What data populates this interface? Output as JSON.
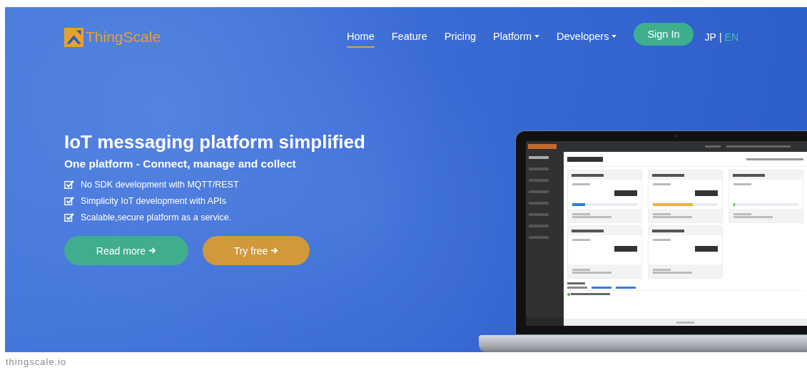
{
  "nav": {
    "logo": "ThingScale",
    "links": [
      {
        "label": "Home",
        "selected": true,
        "dropdown": false
      },
      {
        "label": "Feature",
        "selected": false,
        "dropdown": false
      },
      {
        "label": "Pricing",
        "selected": false,
        "dropdown": false
      },
      {
        "label": "Platform",
        "selected": false,
        "dropdown": true
      },
      {
        "label": "Developers",
        "selected": false,
        "dropdown": true
      }
    ],
    "signin": "Sign In",
    "languages": [
      {
        "label": "JP",
        "selected": false
      },
      {
        "label": "EN",
        "selected": true
      }
    ],
    "separator": "|"
  },
  "hero": {
    "title": "IoT messaging platform simplified",
    "subtitle": "One platform - Connect, manage and collect",
    "features": [
      {
        "text": "No SDK development with MQTT/REST",
        "checked": true
      },
      {
        "text": "Simplicity IoT development with APIs",
        "checked": true
      },
      {
        "text": "Scalable,secure platform as a service.",
        "checked": true
      }
    ],
    "buttons": [
      {
        "label": "Read more",
        "kind": "primary"
      },
      {
        "label": "Try free",
        "kind": "secondary"
      }
    ]
  },
  "caption": "thingscale.io"
}
